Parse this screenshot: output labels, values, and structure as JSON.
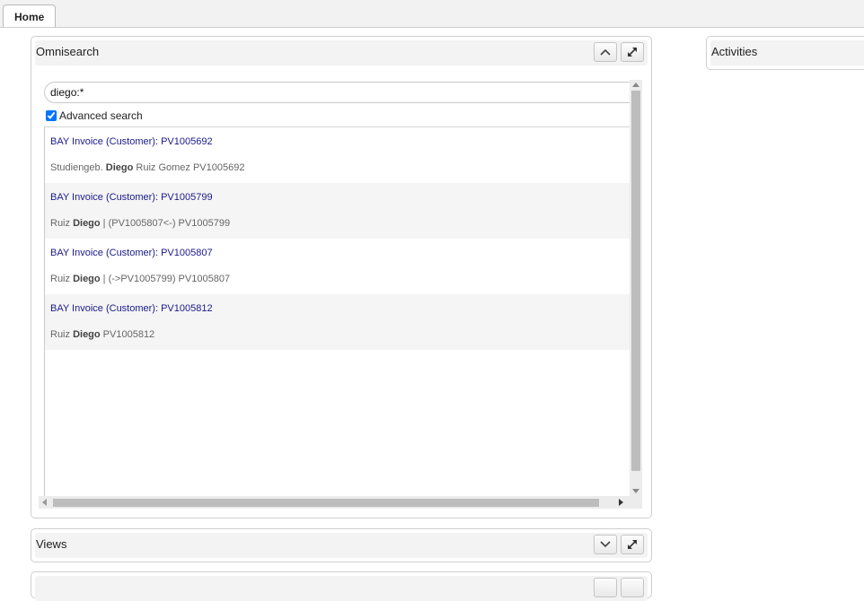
{
  "tabs": [
    {
      "label": "Home"
    }
  ],
  "omnisearch": {
    "title": "Omnisearch",
    "query": "diego:*",
    "advanced_label": "Advanced search",
    "results": [
      {
        "title": "BAY Invoice (Customer): PV1005692",
        "pre": "Studiengeb. ",
        "match": "Diego",
        "post": " Ruiz Gomez PV1005692"
      },
      {
        "title": "BAY Invoice (Customer): PV1005799",
        "pre": "Ruiz ",
        "match": "Diego",
        "post": " | (PV1005807<-) PV1005799"
      },
      {
        "title": "BAY Invoice (Customer): PV1005807",
        "pre": "Ruiz ",
        "match": "Diego",
        "post": " | (->PV1005799) PV1005807"
      },
      {
        "title": "BAY Invoice (Customer): PV1005812",
        "pre": "Ruiz ",
        "match": "Diego",
        "post": " PV1005812"
      }
    ]
  },
  "views": {
    "title": "Views"
  },
  "activities": {
    "title": "Activities"
  }
}
